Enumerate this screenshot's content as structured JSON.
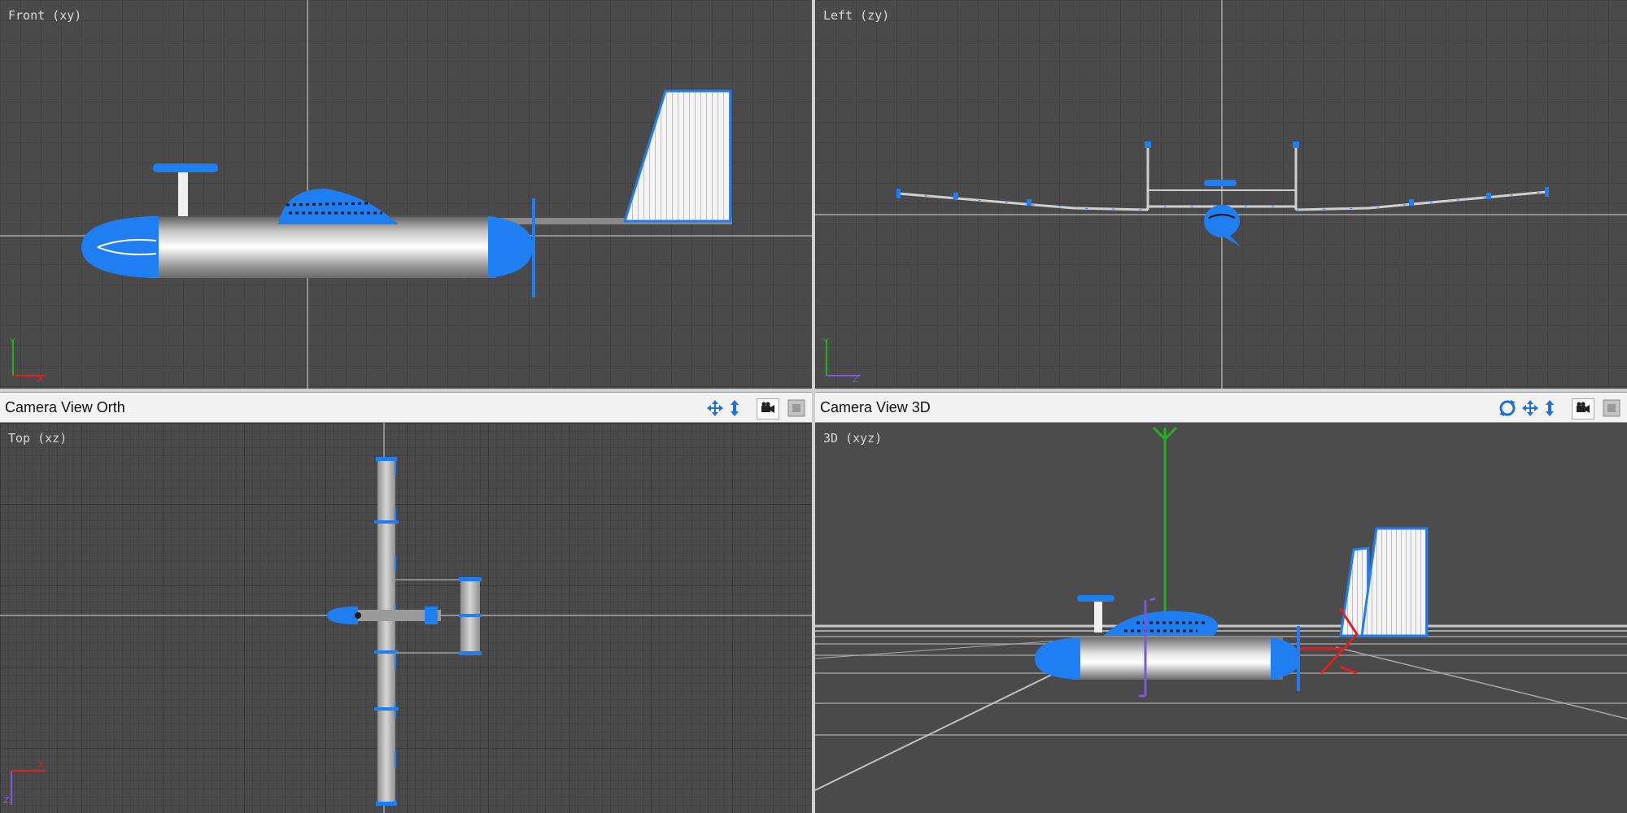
{
  "viewports": {
    "front": {
      "label": "Front (xy)"
    },
    "left": {
      "label": "Left (zy)"
    },
    "top": {
      "label": "Top (xz)"
    },
    "persp": {
      "label": "3D (xyz)"
    }
  },
  "bars": {
    "orth": {
      "title": "Camera View Orth"
    },
    "threed": {
      "title": "Camera View 3D"
    }
  },
  "icons": {
    "pan": "move-arrows-icon",
    "zoom": "vertical-arrows-icon",
    "orbit": "orbit-rotate-icon",
    "camera": "camera-icon",
    "maximize": "maximize-icon"
  },
  "colors": {
    "viewport_bg": "#4a4a4a",
    "grid_line": "#3a3a3a",
    "axis_line": "#a8a8a8",
    "selection_blue": "#1f7ff2",
    "axis_x": "#e02020",
    "axis_y": "#22b022",
    "axis_z": "#7a5ad8"
  }
}
